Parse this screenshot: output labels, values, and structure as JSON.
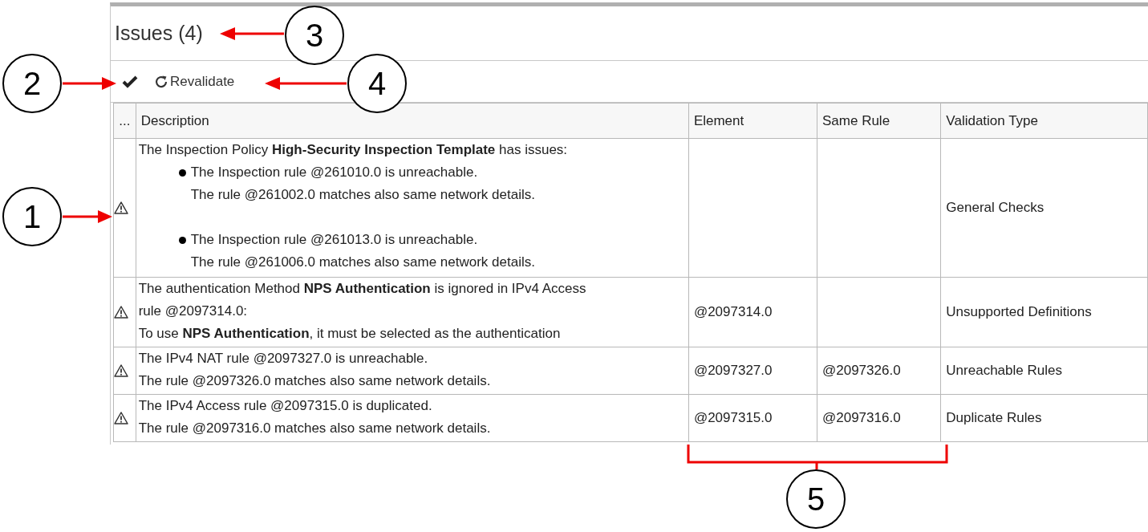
{
  "panel": {
    "title": "Issues (4)"
  },
  "toolbar": {
    "revalidate": "Revalidate"
  },
  "table": {
    "columns": [
      "...",
      "Description",
      "Element",
      "Same Rule",
      "Validation Type"
    ],
    "rows": [
      {
        "description": {
          "intro": "The Inspection Policy **High-Security Inspection Template** has issues:",
          "bullets": [
            [
              "The Inspection rule @261010.0 is unreachable.",
              "The rule @261002.0 matches also same network details."
            ],
            [
              "The Inspection rule @261013.0 is unreachable.",
              "The rule @261006.0 matches also same network details."
            ]
          ]
        },
        "validation_type": "General Checks"
      },
      {
        "description": {
          "lines": [
            "The authentication Method **NPS Authentication** is ignored in IPv4 Access",
            "rule @2097314.0:",
            "To use **NPS Authentication**, it must be selected as the authentication"
          ]
        },
        "element": "@2097314.0",
        "validation_type": "Unsupported Definitions"
      },
      {
        "description": {
          "lines": [
            "The IPv4 NAT rule @2097327.0 is unreachable.",
            "The rule @2097326.0 matches also same network details."
          ]
        },
        "element": "@2097327.0",
        "same_rule": "@2097326.0",
        "validation_type": "Unreachable Rules"
      },
      {
        "description": {
          "lines": [
            "The IPv4 Access rule @2097315.0 is duplicated.",
            "The rule @2097316.0 matches also same network details."
          ]
        },
        "element": "@2097315.0",
        "same_rule": "@2097316.0",
        "validation_type": "Duplicate Rules"
      }
    ]
  },
  "callouts": [
    {
      "label": "1"
    },
    {
      "label": "2"
    },
    {
      "label": "3"
    },
    {
      "label": "4"
    },
    {
      "label": "5"
    }
  ]
}
